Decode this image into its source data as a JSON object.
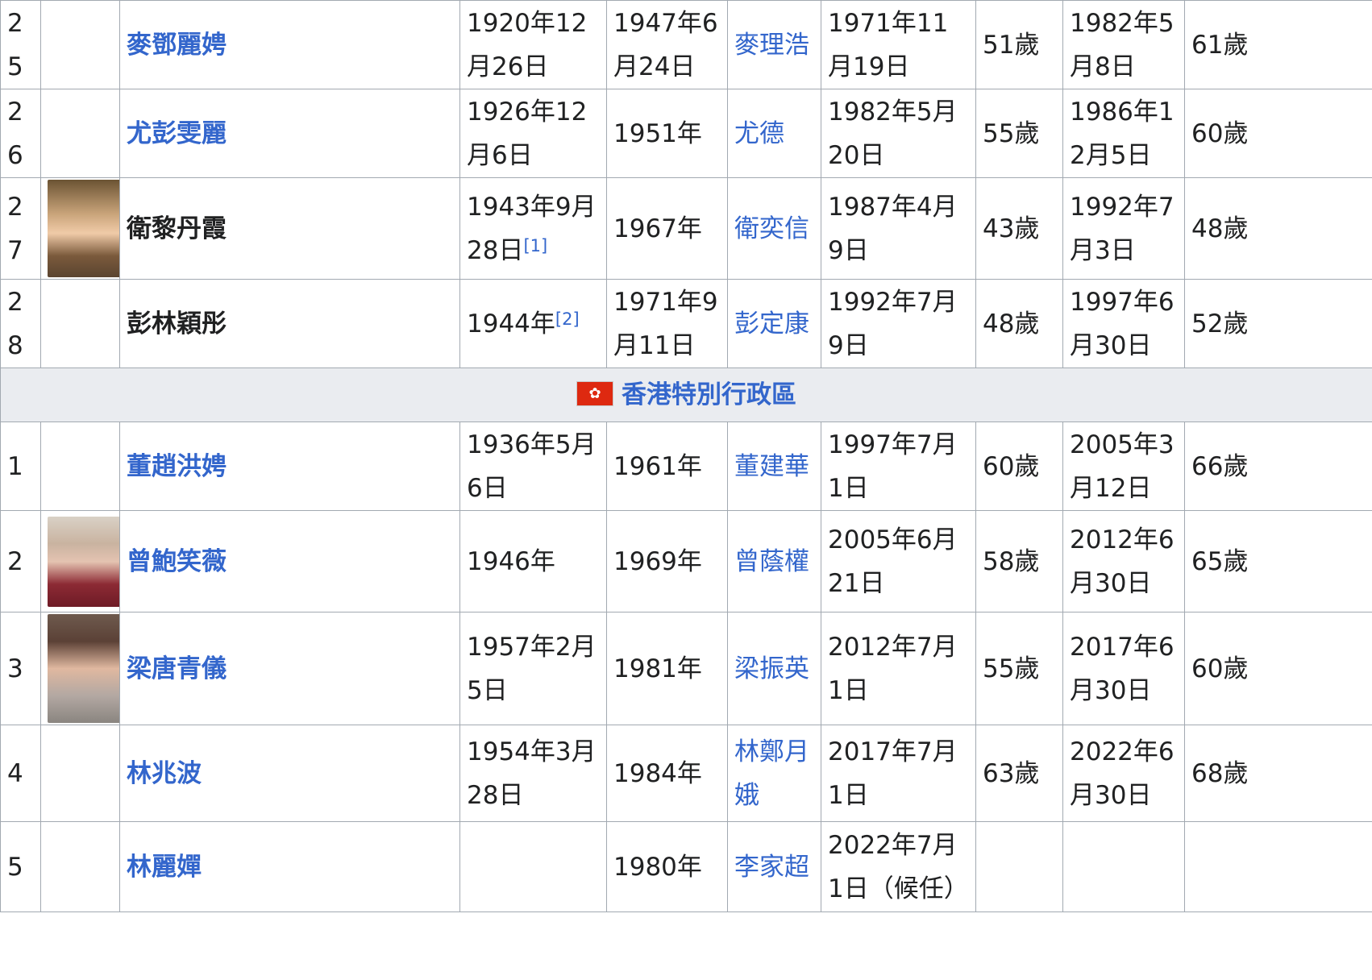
{
  "table": {
    "rows_before": [
      {
        "num": "25",
        "name": "麥鄧麗娉",
        "name_link": true,
        "birth": "1920年12月26日",
        "married": "1947年6月24日",
        "spouse": "麥理浩",
        "start": "1971年11月19日",
        "age_start": "51歲",
        "end": "1982年5月8日",
        "age_end": "61歲"
      },
      {
        "num": "26",
        "name": "尤彭雯麗",
        "name_link": true,
        "birth": "1926年12月6日",
        "married": "1951年",
        "spouse": "尤德",
        "start": "1982年5月20日",
        "age_start": "55歲",
        "end": "1986年12月5日",
        "age_end": "60歲"
      },
      {
        "num": "27",
        "name": "衛黎丹霞",
        "name_link": false,
        "birth": "1943年9月28日",
        "birth_ref": "[1]",
        "married": "1967年",
        "spouse": "衛奕信",
        "start": "1987年4月9日",
        "age_start": "43歲",
        "end": "1992年7月3日",
        "age_end": "48歲",
        "photo": "portrait-photo"
      },
      {
        "num": "28",
        "name": "彭林穎彤",
        "name_link": false,
        "birth": "1944年",
        "birth_ref": "[2]",
        "married": "1971年9月11日",
        "spouse": "彭定康",
        "start": "1992年7月9日",
        "age_start": "48歲",
        "end": "1997年6月30日",
        "age_end": "52歲"
      }
    ],
    "section": {
      "flag_icon": "hk-flag-icon",
      "title": "香港特別行政區"
    },
    "rows_after": [
      {
        "num": "1",
        "name": "董趙洪娉",
        "name_link": true,
        "birth": "1936年5月6日",
        "married": "1961年",
        "spouse": "董建華",
        "start": "1997年7月1日",
        "age_start": "60歲",
        "end": "2005年3月12日",
        "age_end": "66歲"
      },
      {
        "num": "2",
        "name": "曾鮑笑薇",
        "name_link": true,
        "birth": "1946年",
        "married": "1969年",
        "spouse": "曾蔭權",
        "start": "2005年6月21日",
        "age_start": "58歲",
        "end": "2012年6月30日",
        "age_end": "65歲",
        "photo": "portrait-photo"
      },
      {
        "num": "3",
        "name": "梁唐青儀",
        "name_link": true,
        "birth": "1957年2月5日",
        "married": "1981年",
        "spouse": "梁振英",
        "start": "2012年7月1日",
        "age_start": "55歲",
        "end": "2017年6月30日",
        "age_end": "60歲",
        "photo": "portrait-photo"
      },
      {
        "num": "4",
        "name": "林兆波",
        "name_link": true,
        "birth": "1954年3月28日",
        "married": "1984年",
        "spouse": "林鄭月娥",
        "start": "2017年7月1日",
        "age_start": "63歲",
        "end": "2022年6月30日",
        "age_end": "68歲"
      },
      {
        "num": "5",
        "name": "林麗嬋",
        "name_link": true,
        "birth": "",
        "married": "1980年",
        "spouse": "李家超",
        "start": "2022年7月1日（候任）",
        "age_start": "",
        "end": "",
        "age_end": ""
      }
    ]
  },
  "colors": {
    "link": "#3366cc",
    "border": "#a2a9b1",
    "section_bg": "#eaecf0",
    "text": "#202122"
  }
}
